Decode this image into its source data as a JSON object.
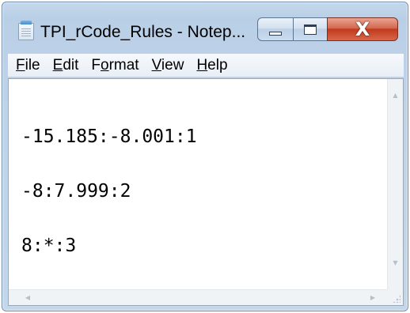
{
  "window": {
    "title": "TPI_rCode_Rules - Notep...",
    "icon": "notepad-icon",
    "close_symbol": "X",
    "colors": {
      "close_button": "#c2391d",
      "frame": "#bcd1e8"
    }
  },
  "menu": {
    "file": {
      "mnemonic": "F",
      "rest": "ile"
    },
    "edit": {
      "mnemonic": "E",
      "rest": "dit"
    },
    "format": {
      "pre": "F",
      "mnemonic": "o",
      "rest": "rmat"
    },
    "view": {
      "mnemonic": "V",
      "rest": "iew"
    },
    "help": {
      "mnemonic": "H",
      "rest": "elp"
    }
  },
  "document": {
    "lines": [
      "-15.185:-8.001:1",
      "-8:7.999:2",
      "8:*:3"
    ]
  }
}
